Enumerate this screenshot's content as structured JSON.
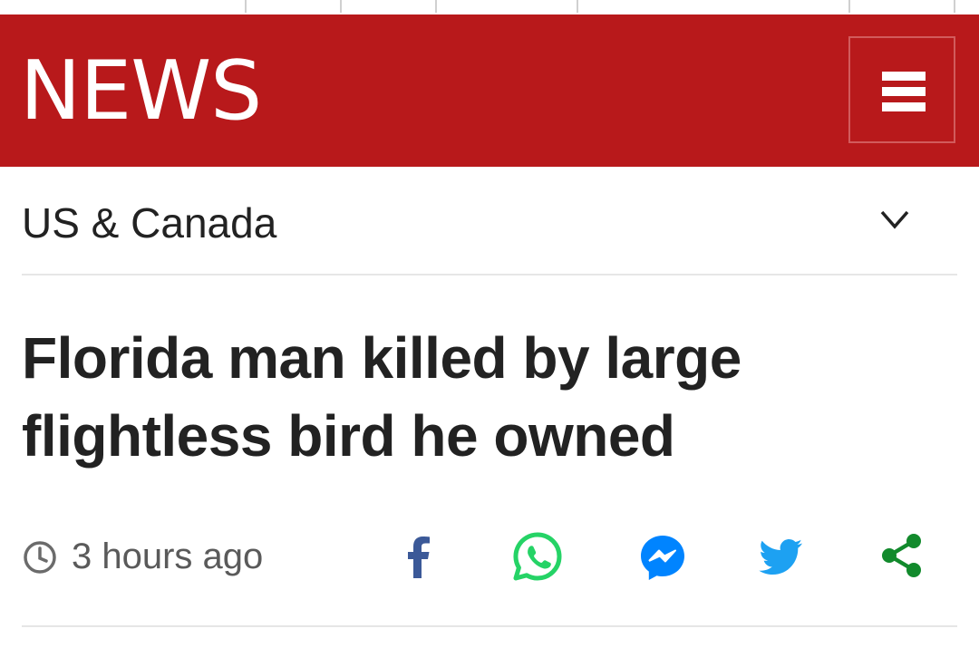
{
  "header": {
    "logo": "NEWS",
    "menu_icon": "hamburger-menu-icon",
    "brand_color": "#b8191b"
  },
  "section": {
    "label": "US & Canada",
    "toggle_icon": "chevron-down-icon"
  },
  "article": {
    "headline": "Florida man killed by large flightless bird he owned",
    "timestamp": "3 hours ago",
    "time_icon": "clock-icon"
  },
  "share": [
    {
      "icon": "facebook-icon",
      "color": "#3b5998"
    },
    {
      "icon": "whatsapp-icon",
      "color": "#25d366"
    },
    {
      "icon": "messenger-icon",
      "color": "#0084ff"
    },
    {
      "icon": "twitter-icon",
      "color": "#1da1f2"
    },
    {
      "icon": "share-icon",
      "color": "#128a2c"
    }
  ]
}
